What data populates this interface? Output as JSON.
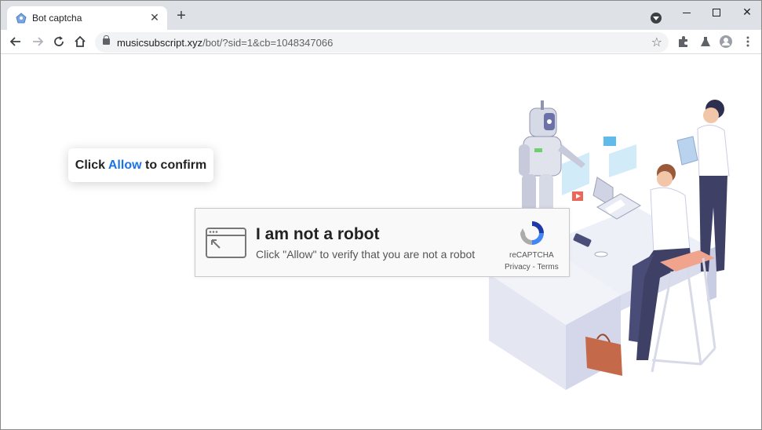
{
  "browser": {
    "tab_title": "Bot captcha",
    "new_tab_label": "+",
    "url_host": "musicsubscript.xyz",
    "url_path": "/bot/?sid=1&cb=1048347066"
  },
  "page": {
    "prompt_prefix": "Click",
    "prompt_highlight": "Allow",
    "prompt_suffix": "to confirm",
    "accent_color": "#1a73e8"
  },
  "captcha": {
    "title": "I am not a robot",
    "subtitle": "Click \"Allow\" to verify that you are not a robot",
    "brand": "reCAPTCHA",
    "links": "Privacy - Terms"
  },
  "icons": [
    "tab-favicon-icon",
    "close-icon",
    "plus-icon",
    "tab-search-icon",
    "back-icon",
    "forward-icon",
    "reload-icon",
    "home-icon",
    "lock-icon",
    "star-icon",
    "extensions-icon",
    "labs-icon",
    "profile-icon",
    "menu-icon",
    "browser-window-icon",
    "recaptcha-icon"
  ]
}
